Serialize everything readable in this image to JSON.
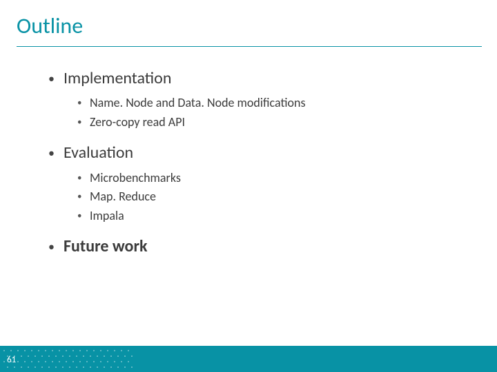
{
  "title": "Outline",
  "page_number": "61",
  "items": [
    {
      "label": "Implementation",
      "bold": false,
      "sub": [
        "Name. Node and Data. Node modifications",
        "Zero-copy read API"
      ]
    },
    {
      "label": "Evaluation",
      "bold": false,
      "sub": [
        "Microbenchmarks",
        "Map. Reduce",
        "Impala"
      ]
    },
    {
      "label": "Future work",
      "bold": true,
      "sub": []
    }
  ]
}
